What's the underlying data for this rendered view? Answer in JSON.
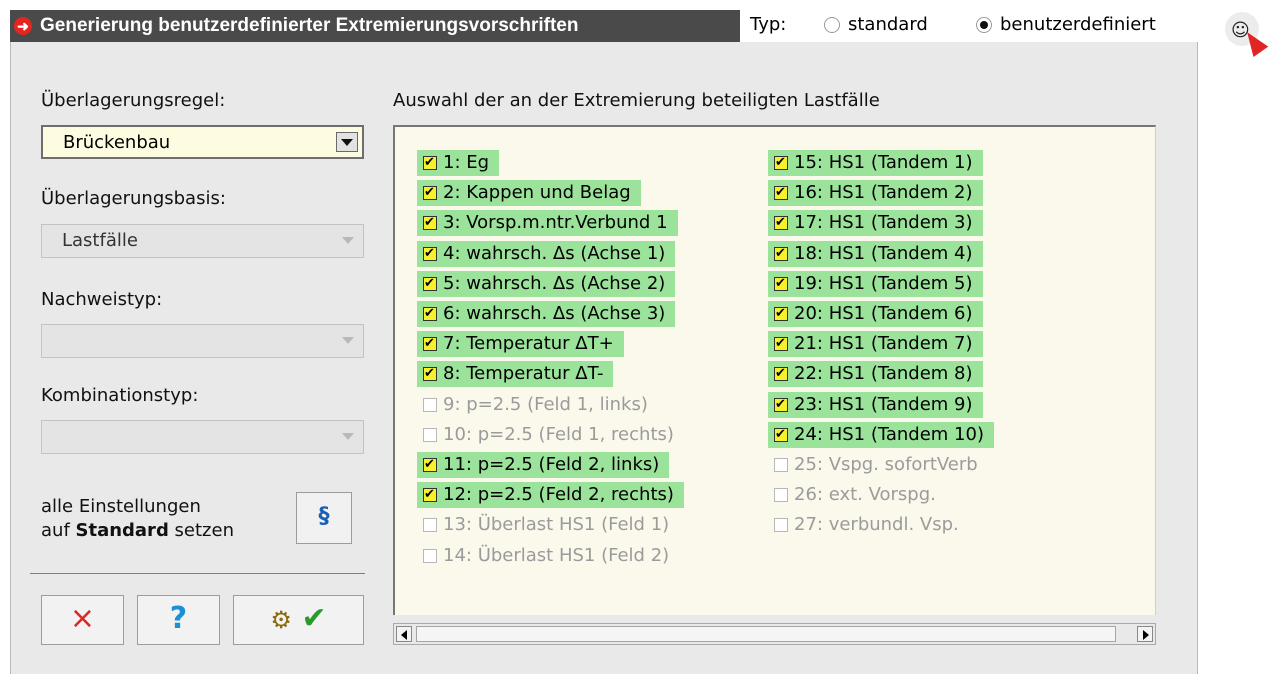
{
  "window": {
    "title": "Generierung benutzerdefinierter Extremierungsvorschriften",
    "title_icon": "red-arrow-right-icon"
  },
  "typ": {
    "label": "Typ:",
    "options": [
      {
        "label": "standard",
        "selected": false
      },
      {
        "label": "benutzerdefiniert",
        "selected": true
      }
    ],
    "help_icon": "help-cursor-icon"
  },
  "left": {
    "ueberlagerungsregel_label": "Überlagerungsregel:",
    "ueberlagerungsregel_value": "Brückenbau",
    "ueberlagerungsbasis_label": "Überlagerungsbasis:",
    "ueberlagerungsbasis_value": "Lastfälle",
    "nachweistyp_label": "Nachweistyp:",
    "nachweistyp_value": "",
    "kombinationstyp_label": "Kombinationstyp:",
    "kombinationstyp_value": "",
    "reset_text_line1": "alle Einstellungen",
    "reset_text_line2_prefix": "auf ",
    "reset_text_line2_bold": "Standard",
    "reset_text_line2_suffix": " setzen",
    "reset_button_label": "§",
    "buttons": {
      "cancel_icon": "×",
      "help_icon": "?",
      "ok_icon": "✔"
    }
  },
  "list": {
    "header": "Auswahl der an der Extremierung beteiligten Lastfälle",
    "col1": [
      {
        "label": "1: Eg",
        "checked": true
      },
      {
        "label": "2: Kappen und Belag",
        "checked": true
      },
      {
        "label": "3: Vorsp.m.ntr.Verbund 1",
        "checked": true
      },
      {
        "label": "4: wahrsch. Δs (Achse 1)",
        "checked": true
      },
      {
        "label": "5: wahrsch. Δs (Achse 2)",
        "checked": true
      },
      {
        "label": "6: wahrsch. Δs (Achse 3)",
        "checked": true
      },
      {
        "label": "7: Temperatur ΔT+",
        "checked": true
      },
      {
        "label": "8: Temperatur ΔT-",
        "checked": true
      },
      {
        "label": "9: p=2.5 (Feld 1, links)",
        "checked": false
      },
      {
        "label": "10: p=2.5 (Feld 1, rechts)",
        "checked": false
      },
      {
        "label": "11: p=2.5 (Feld 2, links)",
        "checked": true
      },
      {
        "label": "12: p=2.5 (Feld 2, rechts)",
        "checked": true
      },
      {
        "label": "13: Überlast HS1 (Feld 1)",
        "checked": false
      },
      {
        "label": "14: Überlast HS1 (Feld 2)",
        "checked": false
      }
    ],
    "col2": [
      {
        "label": "15: HS1 (Tandem 1)",
        "checked": true
      },
      {
        "label": "16: HS1 (Tandem 2)",
        "checked": true
      },
      {
        "label": "17: HS1 (Tandem 3)",
        "checked": true
      },
      {
        "label": "18: HS1 (Tandem 4)",
        "checked": true
      },
      {
        "label": "19: HS1 (Tandem 5)",
        "checked": true
      },
      {
        "label": "20: HS1 (Tandem 6)",
        "checked": true
      },
      {
        "label": "21: HS1 (Tandem 7)",
        "checked": true
      },
      {
        "label": "22: HS1 (Tandem 8)",
        "checked": true
      },
      {
        "label": "23: HS1 (Tandem 9)",
        "checked": true
      },
      {
        "label": "24: HS1 (Tandem 10)",
        "checked": true
      },
      {
        "label": "25: Vspg. sofortVerb",
        "checked": false
      },
      {
        "label": "26: ext. Vorspg.",
        "checked": false
      },
      {
        "label": "27: verbundl. Vsp.",
        "checked": false
      }
    ]
  },
  "colors": {
    "checked_highlight": "#9be39b",
    "checkbox_fill": "#f6f12a",
    "titlebar": "#4a4a4a",
    "accent_red": "#e52520"
  }
}
